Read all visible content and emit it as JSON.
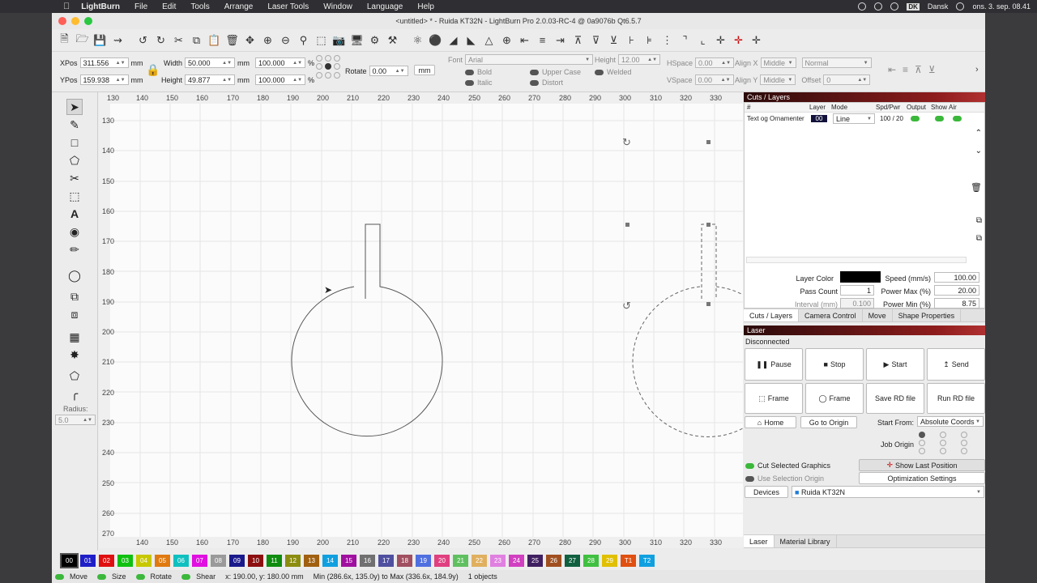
{
  "mac_menu": {
    "app": "LightBurn",
    "items": [
      "File",
      "Edit",
      "Tools",
      "Arrange",
      "Laser Tools",
      "Window",
      "Language",
      "Help"
    ],
    "keyboard": "DK",
    "language": "Dansk",
    "clock": "ons. 3. sep. 08.41"
  },
  "window_title": "<untitled> * - Ruida KT32N - LightBurn Pro 2.0.03-RC-4 @ 0a9076b Qt6.5.7",
  "props": {
    "xpos_label": "XPos",
    "xpos": "311.556",
    "ypos_label": "YPos",
    "ypos": "159.938",
    "unit": "mm",
    "width_label": "Width",
    "width": "50.000",
    "height_label": "Height",
    "height": "49.877",
    "scale_w": "100.000",
    "scale_h": "100.000",
    "pct": "%",
    "rotate_label": "Rotate",
    "rotate": "0.00",
    "mm_button": "mm",
    "font_label": "Font",
    "font": "Arial",
    "fheight_label": "Height",
    "fheight": "12.00",
    "hspace_label": "HSpace",
    "hspace": "0.00",
    "vspace_label": "VSpace",
    "vspace": "0.00",
    "alignx_label": "Align X",
    "alignx": "Middle",
    "aligny_label": "Align Y",
    "aligny": "Middle",
    "normal": "Normal",
    "offset_label": "Offset",
    "offset": "0",
    "bold": "Bold",
    "italic": "Italic",
    "upper": "Upper Case",
    "distort": "Distort",
    "welded": "Welded"
  },
  "left_tools": {
    "radius_label": "Radius:",
    "radius": "5.0"
  },
  "ruler": {
    "top": [
      "130",
      "140",
      "150",
      "160",
      "170",
      "180",
      "190",
      "200",
      "210",
      "220",
      "230",
      "240",
      "250",
      "260",
      "270",
      "280",
      "290",
      "300",
      "310",
      "320",
      "330"
    ],
    "left": [
      "130",
      "140",
      "150",
      "160",
      "170",
      "180",
      "190",
      "200",
      "210",
      "220",
      "230",
      "240",
      "250",
      "260",
      "270"
    ],
    "bottom": [
      "140",
      "150",
      "160",
      "170",
      "180",
      "190",
      "200",
      "210",
      "220",
      "230",
      "240",
      "250",
      "260",
      "270",
      "280",
      "290",
      "300",
      "310",
      "320",
      "330"
    ]
  },
  "cuts": {
    "title": "Cuts / Layers",
    "headers": [
      "#",
      "Layer",
      "Mode",
      "Spd/Pwr",
      "Output",
      "Show",
      "Air"
    ],
    "row": {
      "name": "Text og Ornamenter",
      "layer": "00",
      "mode": "Line",
      "spdpwr": "100 / 20"
    },
    "layer_color": "Layer Color",
    "speed_label": "Speed (mm/s)",
    "speed": "100.00",
    "pass_label": "Pass Count",
    "pass": "1",
    "pmax_label": "Power Max (%)",
    "pmax": "20.00",
    "interval_label": "Interval (mm)",
    "interval": "0.100",
    "pmin_label": "Power Min (%)",
    "pmin": "8.75",
    "tabs": [
      "Cuts / Layers",
      "Camera Control",
      "Move",
      "Shape Properties"
    ]
  },
  "laser": {
    "title": "Laser",
    "status": "Disconnected",
    "pause": "Pause",
    "stop": "Stop",
    "start": "Start",
    "send": "Send",
    "frame1": "Frame",
    "frame2": "Frame",
    "save_rd": "Save RD file",
    "run_rd": "Run RD file",
    "home": "Home",
    "goto_origin": "Go to Origin",
    "start_from_label": "Start From:",
    "start_from": "Absolute Coords",
    "job_origin": "Job Origin",
    "cut_selected": "Cut Selected Graphics",
    "use_selection": "Use Selection Origin",
    "show_last": "Show Last Position",
    "optimization": "Optimization Settings",
    "devices": "Devices",
    "device": "Ruida KT32N",
    "tabs": [
      "Laser",
      "Material Library"
    ]
  },
  "palette": [
    {
      "l": "00",
      "c": "#000000"
    },
    {
      "l": "01",
      "c": "#1f1fc8"
    },
    {
      "l": "02",
      "c": "#e01010"
    },
    {
      "l": "03",
      "c": "#10c010"
    },
    {
      "l": "04",
      "c": "#c8c800"
    },
    {
      "l": "05",
      "c": "#e07a10"
    },
    {
      "l": "06",
      "c": "#10c0c0"
    },
    {
      "l": "07",
      "c": "#e010e0"
    },
    {
      "l": "08",
      "c": "#9a9a9a"
    },
    {
      "l": "09",
      "c": "#1a1a8c"
    },
    {
      "l": "10",
      "c": "#8c1010"
    },
    {
      "l": "11",
      "c": "#108c10"
    },
    {
      "l": "12",
      "c": "#8c8c10"
    },
    {
      "l": "13",
      "c": "#a06010"
    },
    {
      "l": "14",
      "c": "#10a0e0"
    },
    {
      "l": "15",
      "c": "#a010a0"
    },
    {
      "l": "16",
      "c": "#707070"
    },
    {
      "l": "17",
      "c": "#5050a0"
    },
    {
      "l": "18",
      "c": "#a05060"
    },
    {
      "l": "19",
      "c": "#5070e0"
    },
    {
      "l": "20",
      "c": "#e04080"
    },
    {
      "l": "21",
      "c": "#60c060"
    },
    {
      "l": "22",
      "c": "#e0b060"
    },
    {
      "l": "23",
      "c": "#e080e0"
    },
    {
      "l": "24",
      "c": "#d040c0"
    },
    {
      "l": "25",
      "c": "#402060"
    },
    {
      "l": "26",
      "c": "#a05020"
    },
    {
      "l": "27",
      "c": "#106040"
    },
    {
      "l": "28",
      "c": "#40c040"
    },
    {
      "l": "29",
      "c": "#e0c000"
    },
    {
      "l": "T1",
      "c": "#e05010"
    },
    {
      "l": "T2",
      "c": "#10a0e0"
    }
  ],
  "status": {
    "move": "Move",
    "size": "Size",
    "rotate": "Rotate",
    "shear": "Shear",
    "coords": "x: 190.00, y: 180.00 mm",
    "minmax": "Min (286.6x, 135.0y) to Max (336.6x, 184.9y)",
    "objects": "1 objects"
  }
}
